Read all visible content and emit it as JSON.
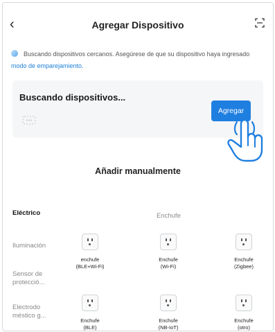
{
  "header": {
    "title": "Agregar Dispositivo"
  },
  "info": {
    "text": "Buscando dispositivos cercanos. Asegúrese de que su dispositivo haya ingresado",
    "link": "modo de emparejamiento."
  },
  "search_card": {
    "title": "Buscando dispositivos...",
    "add_button": "Agregar"
  },
  "manual": {
    "title": "Añadir manualmente"
  },
  "categories": [
    {
      "label": "Eléctrico",
      "active": true
    },
    {
      "label": "Iluminación",
      "active": false
    },
    {
      "label": "Sensor de protecció...",
      "active": false
    },
    {
      "label": "Electrodo méstico g...",
      "active": false
    }
  ],
  "subcategory": "Enchufe",
  "devices": [
    {
      "name": "enchufe",
      "type": "(BLE+Wi-Fi)"
    },
    {
      "name": "Enchufe",
      "type": "(Wi-Fi)"
    },
    {
      "name": "Enchufe",
      "type": "(Zigbee)"
    },
    {
      "name": "Enchufe",
      "type": "(BLE)"
    },
    {
      "name": "Enchufe",
      "type": "(NB-IoT)"
    },
    {
      "name": "Enchufe",
      "type": "(otro)"
    }
  ],
  "colors": {
    "accent": "#1f7fe0",
    "link": "#1e7fd6",
    "card_bg": "#f5f6f7"
  },
  "icons": [
    "back-icon",
    "scan-icon",
    "bluetooth-search-icon",
    "pointer-hand-icon",
    "socket-icon"
  ]
}
